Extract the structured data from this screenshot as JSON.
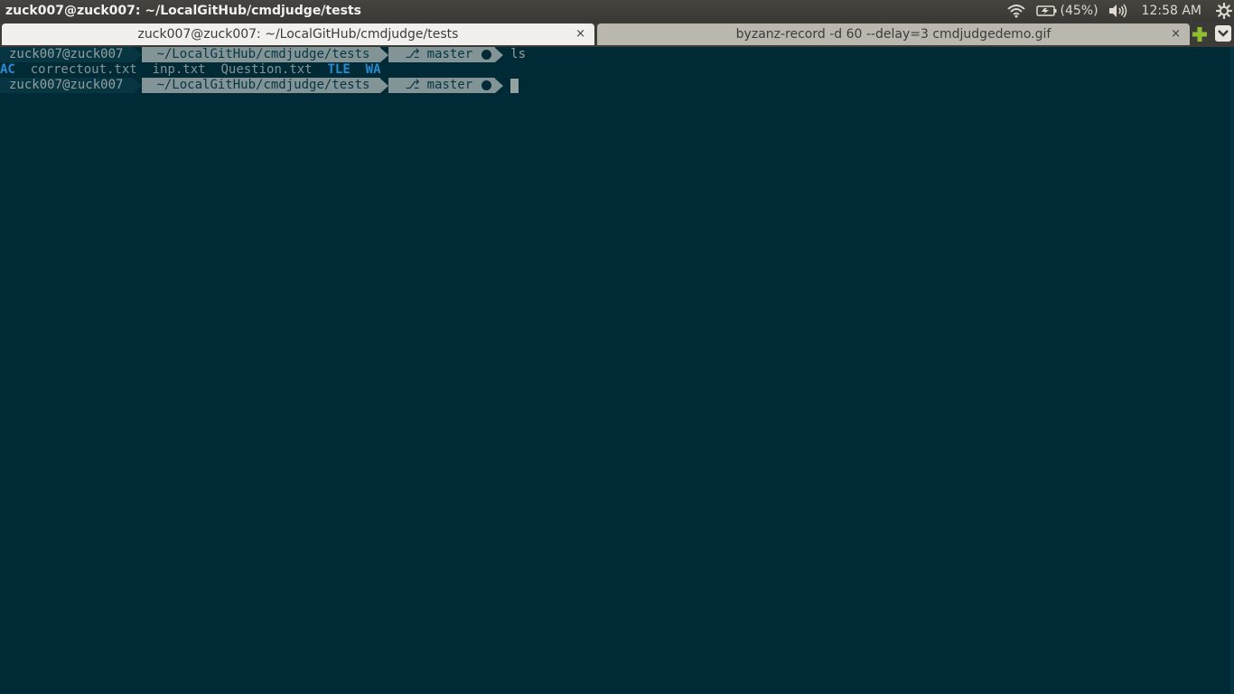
{
  "top_panel": {
    "window_title": "zuck007@zuck007: ~/LocalGitHub/cmdjudge/tests",
    "battery_text": "(45%)",
    "clock": "12:58 AM",
    "icons": [
      "wifi-icon",
      "battery-icon",
      "volume-icon",
      "gear-icon"
    ]
  },
  "tabs": [
    {
      "label": "zuck007@zuck007: ~/LocalGitHub/cmdjudge/tests",
      "close": "×",
      "active": true
    },
    {
      "label": "byzanz-record -d 60 --delay=3 cmdjudgedemo.gif",
      "close": "×",
      "active": false
    }
  ],
  "terminal": {
    "prompt_user": "zuck007@zuck007",
    "prompt_dir": "~/LocalGitHub/cmdjudge/tests",
    "prompt_branch": "master",
    "command": "ls",
    "ls_output": [
      {
        "name": "AC",
        "kind": "dir"
      },
      {
        "name": "correctout.txt",
        "kind": "file"
      },
      {
        "name": "inp.txt",
        "kind": "file"
      },
      {
        "name": "Question.txt",
        "kind": "file"
      },
      {
        "name": "TLE",
        "kind": "dir"
      },
      {
        "name": "WA",
        "kind": "dir"
      }
    ]
  },
  "colors": {
    "terminal_bg": "#002b36",
    "dir_blue": "#268bd2",
    "panel_bg": "#3c3b37",
    "new_tab_accent": "#8fbf2f"
  }
}
